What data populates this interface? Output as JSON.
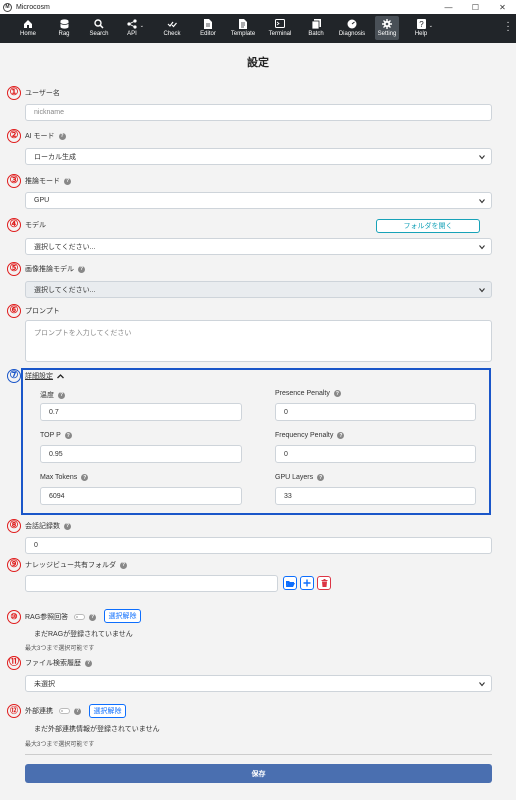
{
  "window": {
    "title": "Microcosm",
    "logo_text": "M",
    "minimize": "—",
    "maximize": "☐",
    "close": "✕"
  },
  "nav": [
    {
      "label": "Home",
      "icon": "home-icon"
    },
    {
      "label": "Rag",
      "icon": "database-icon"
    },
    {
      "label": "Search",
      "icon": "search-icon"
    },
    {
      "label": "API",
      "icon": "share-icon"
    },
    {
      "label": "Check",
      "icon": "check-icon"
    },
    {
      "label": "Editor",
      "icon": "editor-icon"
    },
    {
      "label": "Template",
      "icon": "template-icon"
    },
    {
      "label": "Terminal",
      "icon": "terminal-icon"
    },
    {
      "label": "Batch",
      "icon": "batch-icon"
    },
    {
      "label": "Diagnosis",
      "icon": "diagnosis-icon"
    },
    {
      "label": "Setting",
      "icon": "gear-icon"
    },
    {
      "label": "Help",
      "icon": "help-icon"
    }
  ],
  "page_title": "設定",
  "markers": [
    "①",
    "②",
    "③",
    "④",
    "⑤",
    "⑥",
    "⑦",
    "⑧",
    "⑨",
    "⑩",
    "⑪",
    "⑫"
  ],
  "user_name": {
    "label": "ユーザー名",
    "placeholder": "nickname"
  },
  "ai_mode": {
    "label": "AI モード",
    "value": "ローカル生成"
  },
  "inference_mode": {
    "label": "推論モード",
    "value": "GPU"
  },
  "model": {
    "label": "モデル",
    "open_folder": "フォルダを開く",
    "value": "選択してください..."
  },
  "image_model": {
    "label": "画像推論モデル",
    "value": "選択してください..."
  },
  "prompt": {
    "label": "プロンプト",
    "placeholder": "プロンプトを入力してください"
  },
  "advanced": {
    "label": "詳細設定",
    "temperature": {
      "label": "温度",
      "value": "0.7"
    },
    "presence_penalty": {
      "label": "Presence Penalty",
      "value": "0"
    },
    "top_p": {
      "label": "TOP P",
      "value": "0.95"
    },
    "frequency_penalty": {
      "label": "Frequency Penalty",
      "value": "0"
    },
    "max_tokens": {
      "label": "Max Tokens",
      "value": "6094"
    },
    "gpu_layers": {
      "label": "GPU Layers",
      "value": "33"
    }
  },
  "history_count": {
    "label": "会話記録数",
    "value": "0"
  },
  "knowledge_folder": {
    "label": "ナレッジビュー共有フォルダ",
    "value": ""
  },
  "rag_ref": {
    "label": "RAG参照回答",
    "deselect": "選択解除",
    "empty": "まだRAGが登録されていません",
    "limit": "最大3つまで選択可能です"
  },
  "file_search": {
    "label": "ファイル検索履歴",
    "value": "未選択"
  },
  "external": {
    "label": "外部連携",
    "deselect": "選択解除",
    "empty": "まだ外部連携情報が登録されていません",
    "limit": "最大3つまで選択可能です"
  },
  "save_label": "保存",
  "colors": {
    "accent": "#0d6efd",
    "marker": "#e01e1e",
    "box": "#1a56c9",
    "nav_bg": "#212529",
    "save_bg": "#4a6fb0"
  }
}
